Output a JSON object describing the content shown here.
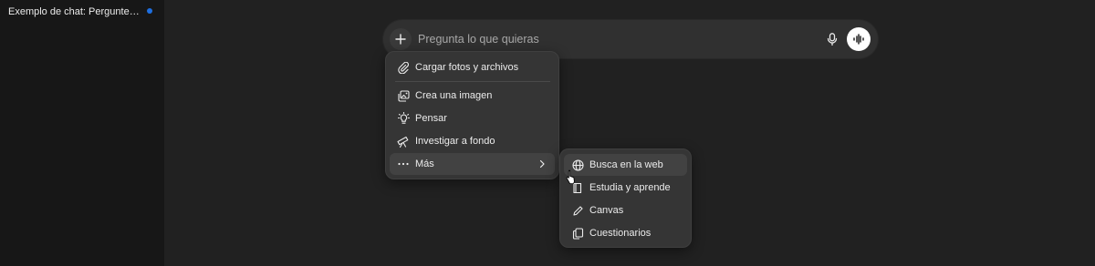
{
  "sidebar": {
    "chat_title": "Exemplo de chat: Pergunte o q..."
  },
  "composer": {
    "placeholder": "Pregunta lo que quieras"
  },
  "attach_menu": {
    "items": [
      {
        "label": "Cargar fotos y archivos",
        "icon": "paperclip-icon"
      },
      {
        "label": "Crea una imagen",
        "icon": "image-icon"
      },
      {
        "label": "Pensar",
        "icon": "lightbulb-icon"
      },
      {
        "label": "Investigar a fondo",
        "icon": "telescope-icon"
      },
      {
        "label": "Más",
        "icon": "more-dots-icon"
      }
    ]
  },
  "more_submenu": {
    "items": [
      {
        "label": "Busca en la web",
        "icon": "globe-icon"
      },
      {
        "label": "Estudia y aprende",
        "icon": "book-icon"
      },
      {
        "label": "Canvas",
        "icon": "pencil-icon"
      },
      {
        "label": "Cuestionarios",
        "icon": "cards-icon"
      }
    ]
  },
  "colors": {
    "background": "#212121",
    "sidebar": "#171717",
    "menu": "#353535",
    "unread_dot": "#1e6fe0"
  }
}
